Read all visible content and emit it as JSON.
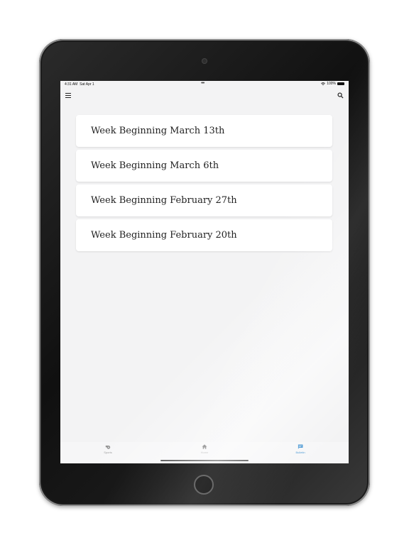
{
  "status_bar": {
    "time": "4:31 AM",
    "date": "Sat Apr 1",
    "center_dots": "•••",
    "battery_text": "100%",
    "battery_level": 1.0
  },
  "toolbar": {
    "menu_icon": "hamburger-menu-icon",
    "search_icon": "search-icon"
  },
  "list": {
    "items": [
      {
        "label": "Week Beginning March 13th"
      },
      {
        "label": "Week Beginning March 6th"
      },
      {
        "label": "Week Beginning February 27th"
      },
      {
        "label": "Week Beginning February 20th"
      }
    ]
  },
  "tabs": [
    {
      "label": "Sports",
      "icon": "whistle-icon",
      "active": false
    },
    {
      "label": "Home",
      "icon": "home-icon",
      "active": false
    },
    {
      "label": "Bulletin",
      "icon": "chat-bubble-icon",
      "active": true
    }
  ],
  "colors": {
    "accent": "#3a8fd0",
    "screen_background": "#f3f3f4",
    "card_background": "#ffffff",
    "device_frame": "#1a1a1a"
  }
}
